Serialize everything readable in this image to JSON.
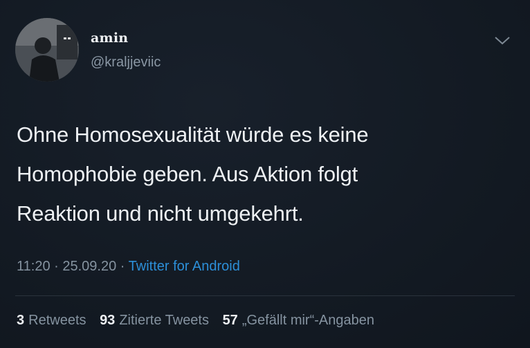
{
  "user": {
    "display_name": "amin",
    "handle": "@kraljjeviic",
    "avatar": "profile-photo"
  },
  "tweet": {
    "lines": [
      "Ohne Homosexualität würde es keine",
      "Homophobie geben. Aus Aktion folgt",
      "Reaktion und nicht umgekehrt."
    ]
  },
  "meta": {
    "time": "11:20",
    "separator": "·",
    "date": "25.09.20",
    "source": "Twitter for Android"
  },
  "stats": {
    "retweets_count": "3",
    "retweets_label": "Retweets",
    "quote_count": "93",
    "quote_label": "Zitierte Tweets",
    "likes_count": "57",
    "likes_label": "„Gefällt mir“-Angaben"
  },
  "icons": {
    "menu": "chevron-down-icon"
  },
  "colors": {
    "background": "#141b24",
    "link": "#2c8fd8",
    "muted": "#8593a0"
  }
}
